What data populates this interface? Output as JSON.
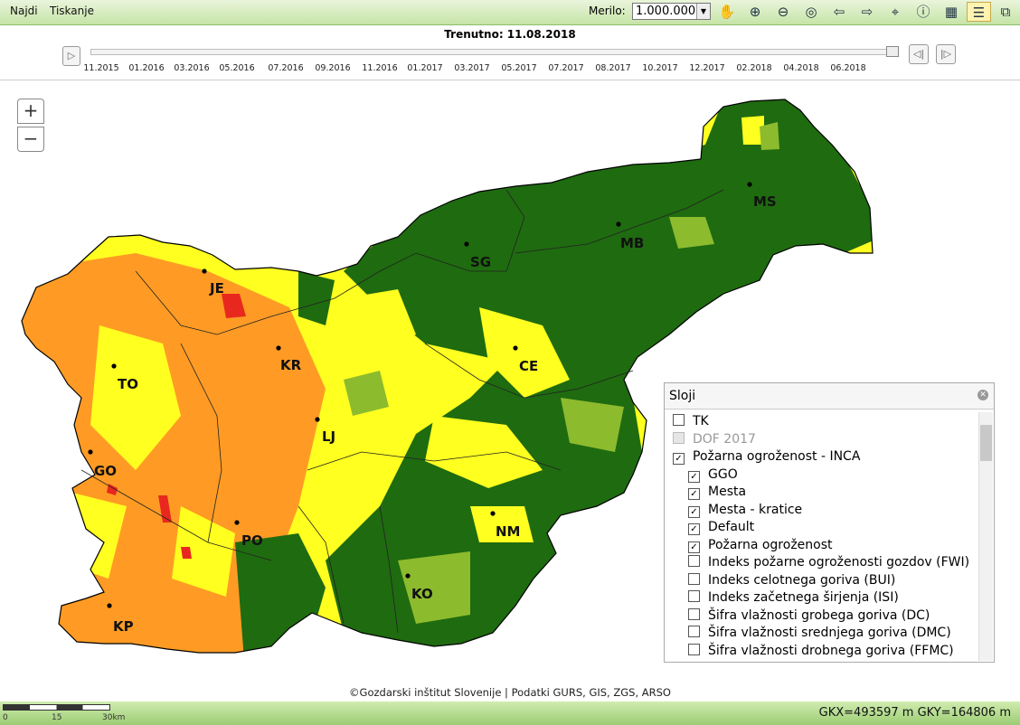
{
  "menu": {
    "najdi": "Najdi",
    "tiskanje": "Tiskanje"
  },
  "toolbar": {
    "merilo_label": "Merilo:",
    "scale_value": "1.000.000",
    "tools": [
      "pan-hand-icon",
      "zoom-in-icon",
      "zoom-out-icon",
      "zoom-extent-icon",
      "back-arrow-icon",
      "forward-arrow-icon",
      "xy-coordinate-icon",
      "info-icon",
      "measure-icon",
      "layers-icon",
      "search-window-icon"
    ]
  },
  "timeline": {
    "current": "Trenutno: 11.08.2018",
    "ticks": [
      "11.2015",
      "01.2016",
      "03.2016",
      "05.2016",
      "07.2016",
      "09.2016",
      "11.2016",
      "01.2017",
      "03.2017",
      "05.2017",
      "07.2017",
      "08.2017",
      "10.2017",
      "12.2017",
      "02.2018",
      "04.2018",
      "06.2018"
    ]
  },
  "zoom": {
    "in": "+",
    "out": "−"
  },
  "map": {
    "cities": [
      "JE",
      "KR",
      "TO",
      "GO",
      "LJ",
      "PO",
      "KP",
      "SG",
      "MB",
      "MS",
      "CE",
      "NM",
      "KO"
    ],
    "colors": {
      "green": "#1f6b10",
      "lightgreen": "#8dbb2e",
      "yellow": "#ffff20",
      "orange": "#ff9b24",
      "red": "#e8281e"
    }
  },
  "layers": {
    "title": "Sloji",
    "items": [
      {
        "label": "TK",
        "checked": false,
        "disabled": false,
        "indent": 0
      },
      {
        "label": "DOF 2017",
        "checked": false,
        "disabled": true,
        "indent": 0
      },
      {
        "label": "Požarna ogroženost - INCA",
        "checked": true,
        "disabled": false,
        "indent": 0
      },
      {
        "label": "GGO",
        "checked": true,
        "disabled": false,
        "indent": 1
      },
      {
        "label": "Mesta",
        "checked": true,
        "disabled": false,
        "indent": 1
      },
      {
        "label": "Mesta - kratice",
        "checked": true,
        "disabled": false,
        "indent": 1
      },
      {
        "label": "Default",
        "checked": true,
        "disabled": false,
        "indent": 1
      },
      {
        "label": "Požarna ogroženost",
        "checked": true,
        "disabled": false,
        "indent": 1
      },
      {
        "label": "Indeks požarne ogroženosti gozdov (FWI)",
        "checked": false,
        "disabled": false,
        "indent": 1
      },
      {
        "label": "Indeks celotnega goriva (BUI)",
        "checked": false,
        "disabled": false,
        "indent": 1
      },
      {
        "label": "Indeks začetnega širjenja (ISI)",
        "checked": false,
        "disabled": false,
        "indent": 1
      },
      {
        "label": "Šifra vlažnosti grobega goriva (DC)",
        "checked": false,
        "disabled": false,
        "indent": 1
      },
      {
        "label": "Šifra vlažnosti srednjega goriva (DMC)",
        "checked": false,
        "disabled": false,
        "indent": 1
      },
      {
        "label": "Šifra vlažnosti drobnega goriva (FFMC)",
        "checked": false,
        "disabled": false,
        "indent": 1
      }
    ]
  },
  "footer": {
    "copyright": "©Gozdarski inštitut Slovenije | Podatki GURS, GIS, ZGS, ARSO",
    "coords": "GKX=493597 m GKY=164806 m",
    "scale_ticks": [
      "0",
      "15",
      "30km"
    ]
  }
}
